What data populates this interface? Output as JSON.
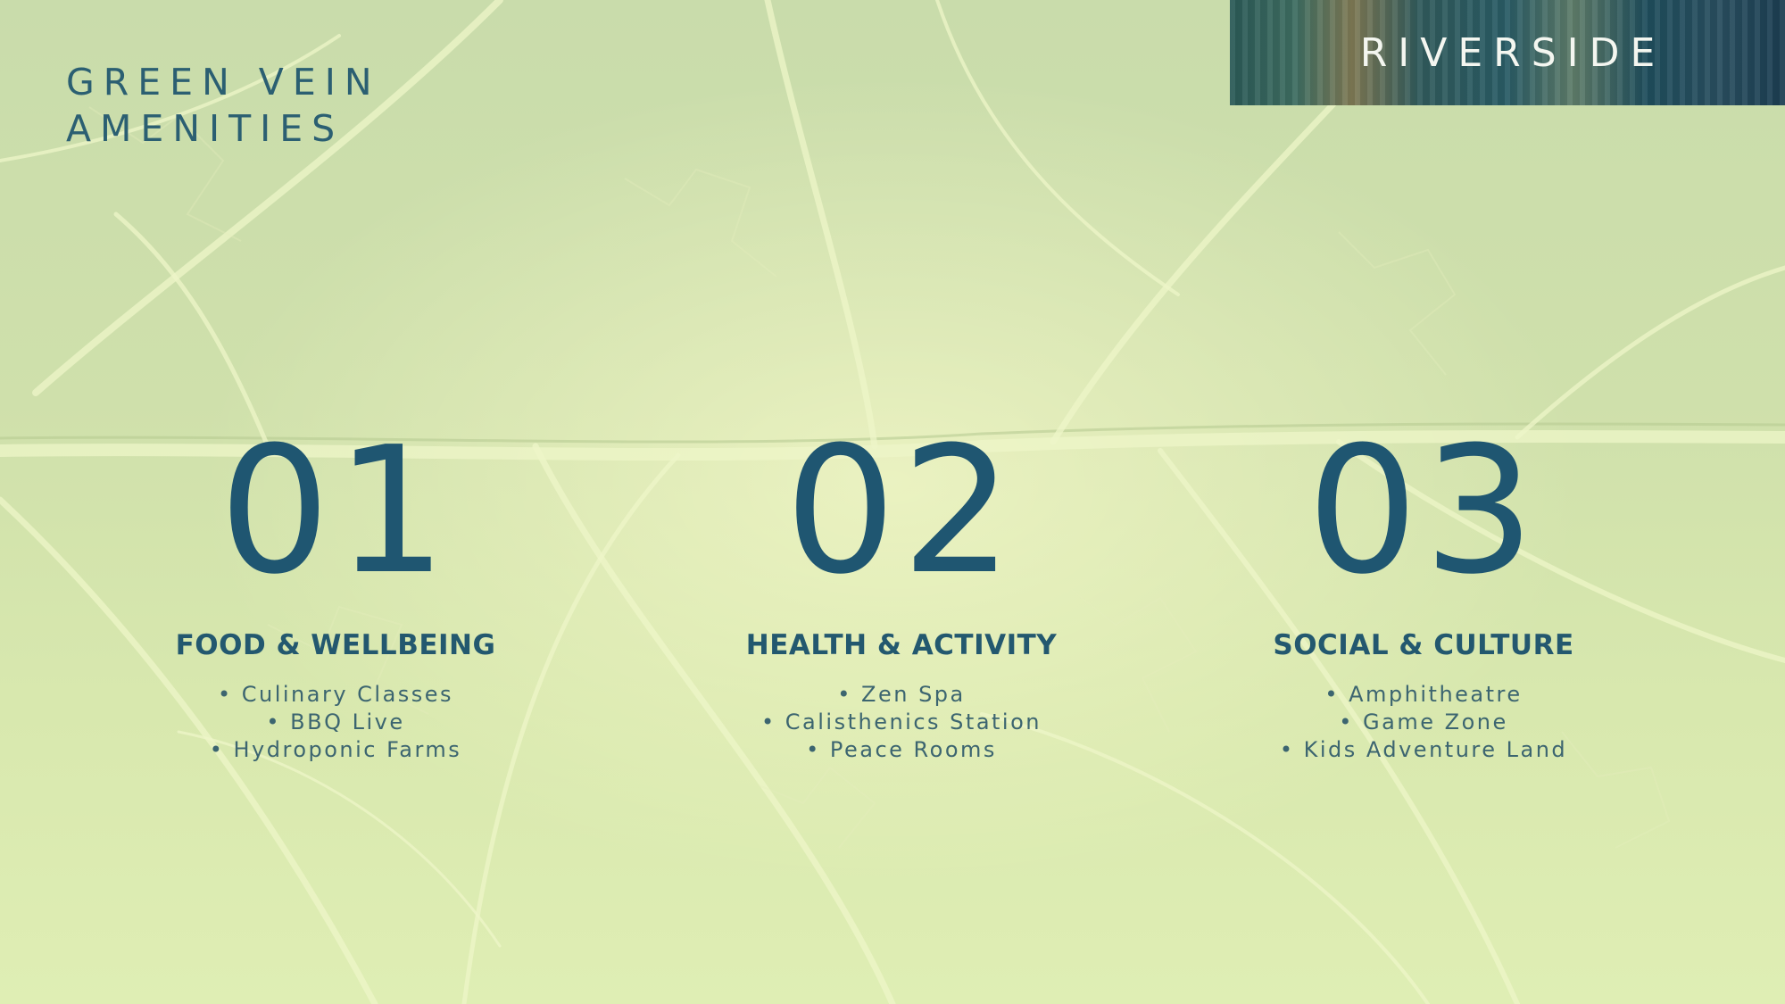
{
  "brand": {
    "name": "RIVERSIDE"
  },
  "title": {
    "line1": "GREEN VEIN",
    "line2": "AMENITIES"
  },
  "columns": [
    {
      "number": "01",
      "category": "FOOD & WELLBEING",
      "items": [
        "• Culinary Classes",
        "• BBQ Live",
        "• Hydroponic Farms"
      ]
    },
    {
      "number": "02",
      "category": "HEALTH & ACTIVITY",
      "items": [
        "• Zen Spa",
        "• Calisthenics Station",
        "• Peace Rooms"
      ]
    },
    {
      "number": "03",
      "category": "SOCIAL & CULTURE",
      "items": [
        "• Amphitheatre",
        "• Game Zone",
        "• Kids Adventure Land"
      ]
    }
  ],
  "colors": {
    "accent": "#1f5671",
    "background": "#d2e3ac",
    "brand_text": "#f4f6f0"
  }
}
